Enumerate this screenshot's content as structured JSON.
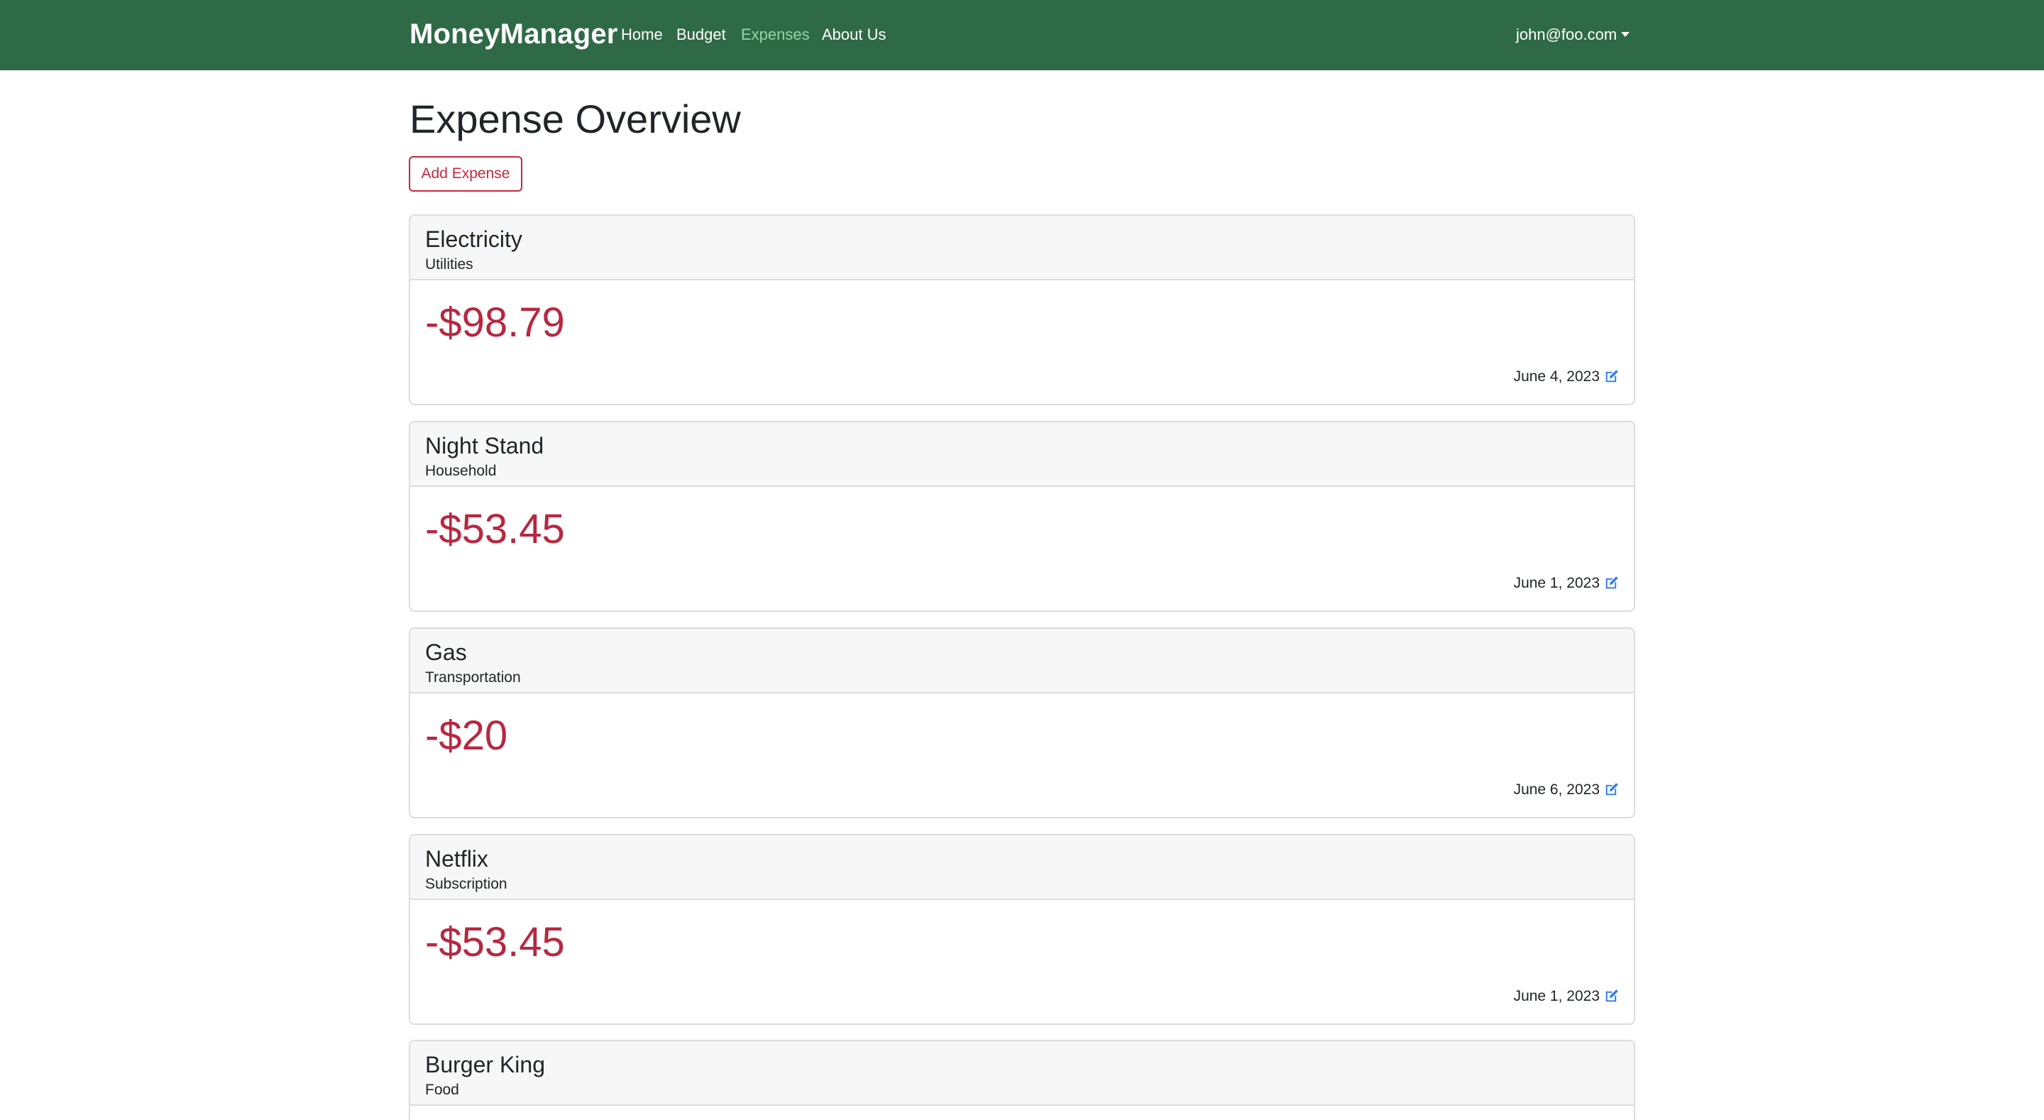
{
  "navbar": {
    "brand": "MoneyManager",
    "links": [
      {
        "label": "Home",
        "active": false
      },
      {
        "label": "Budget",
        "active": false
      },
      {
        "label": "Expenses",
        "active": true
      },
      {
        "label": "About Us",
        "active": false
      }
    ],
    "user_email": "john@foo.com",
    "user_menu_icon": "caret-down-icon"
  },
  "page": {
    "title": "Expense Overview",
    "add_button_label": "Add Expense"
  },
  "expenses": [
    {
      "name": "Electricity",
      "category": "Utilities",
      "amount": "-$98.79",
      "date": "June 4, 2023",
      "action_icon": "edit-icon"
    },
    {
      "name": "Night Stand",
      "category": "Household",
      "amount": "-$53.45",
      "date": "June 1, 2023",
      "action_icon": "edit-icon"
    },
    {
      "name": "Gas",
      "category": "Transportation",
      "amount": "-$20",
      "date": "June 6, 2023",
      "action_icon": "edit-icon"
    },
    {
      "name": "Netflix",
      "category": "Subscription",
      "amount": "-$53.45",
      "date": "June 1, 2023",
      "action_icon": "edit-icon"
    },
    {
      "name": "Burger King",
      "category": "Food"
    }
  ],
  "colors": {
    "navbar_bg": "#2f6a46",
    "active_link": "#8fd8aa",
    "accent_red": "#c5283d",
    "amount_red": "#b72840",
    "edit_icon_blue": "#2f7ce6"
  }
}
